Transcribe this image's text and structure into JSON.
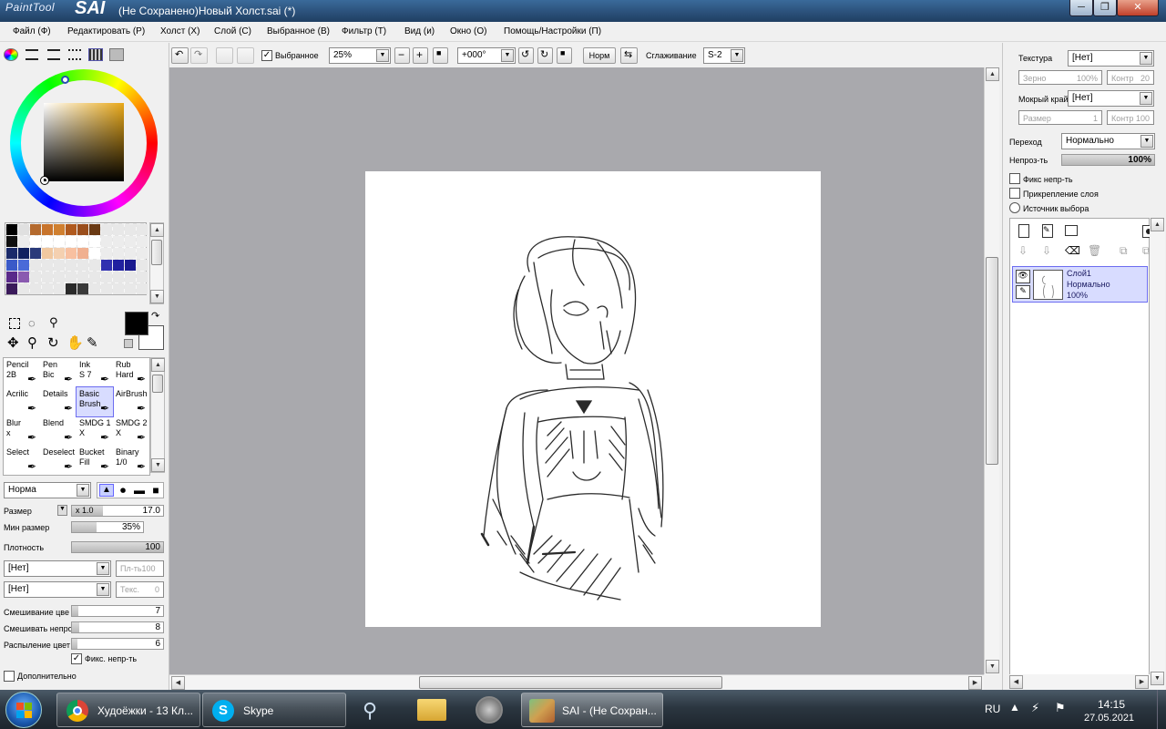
{
  "window": {
    "logo_small": "PaintTool",
    "logo_big": "SAI",
    "title": "(Не Сохранено)Новый Холст.sai (*)",
    "min": "─",
    "max": "❐",
    "close": "✕"
  },
  "menu": {
    "items": [
      "Файл (Ф)",
      "Редактировать (Р)",
      "Холст (Х)",
      "Слой (С)",
      "Выбранное (В)",
      "Фильтр (Т)",
      "Вид (и)",
      "Окно (О)",
      "Помощь/Настройки (П)"
    ]
  },
  "toolbar": {
    "selected_label": "Выбранное",
    "zoom": "25%",
    "rotation": "+000°",
    "norm": "Норм",
    "smoothing_label": "Сглаживание",
    "smoothing_value": "S-2"
  },
  "colors": {
    "title_blue": "#2a4f78",
    "canvas_bg": "#a9a9ad",
    "paper": "#ffffff",
    "selection": "#d8dcff",
    "primary": "#000000",
    "secondary": "#ffffff"
  },
  "swatches": [
    [
      "#000000",
      "#e0e0e0",
      "#b46a2e",
      "#c8742c",
      "#d08030",
      "#b05a1e",
      "#9a4e1c",
      "#6a3a14",
      "#e8e8e8",
      "#e8e8e8",
      "#e8e8e8",
      "#e8e8e8"
    ],
    [
      "#101010",
      "#ececec",
      "#ffffff",
      "#ffffff",
      "#ffffff",
      "#ffffff",
      "#ffffff",
      "#ffffff",
      "#ececec",
      "#ececec",
      "#ececec",
      "#ececec"
    ],
    [
      "#1a2a6a",
      "#102060",
      "#2a3a7a",
      "#f0c8a0",
      "#f4d0b0",
      "#f8c0a0",
      "#f0b090",
      "#ffffff",
      "#ececec",
      "#ececec",
      "#ececec",
      "#ececec"
    ],
    [
      "#3a5ac8",
      "#4a6ad8",
      "#e8e8e8",
      "#e8e8e8",
      "#e8e8e8",
      "#e8e8e8",
      "#e8e8e8",
      "#e8e8e8",
      "#3030b0",
      "#2020a0",
      "#1a1a90",
      "#e8e8e8"
    ],
    [
      "#5a2a8a",
      "#8a5ab0",
      "#e8e8e8",
      "#e8e8e8",
      "#e8e8e8",
      "#e8e8e8",
      "#e8e8e8",
      "#e8e8e8",
      "#e8e8e8",
      "#e8e8e8",
      "#e8e8e8",
      "#e8e8e8"
    ],
    [
      "#3a1a5a",
      "#e8e8e8",
      "#e8e8e8",
      "#e8e8e8",
      "#e8e8e8",
      "#2a2a2a",
      "#3a3a3a",
      "#e8e8e8",
      "#e8e8e8",
      "#e8e8e8",
      "#e8e8e8",
      "#e8e8e8"
    ]
  ],
  "tools": [
    {
      "l1": "Pencil",
      "l2": "2B"
    },
    {
      "l1": "Pen",
      "l2": "Bic"
    },
    {
      "l1": "Ink",
      "l2": "S 7"
    },
    {
      "l1": "Rub",
      "l2": "Hard"
    },
    {
      "l1": "Acrilic",
      "l2": ""
    },
    {
      "l1": "Details",
      "l2": ""
    },
    {
      "l1": "Basic",
      "l2": "Brush"
    },
    {
      "l1": "AirBrush",
      "l2": ""
    },
    {
      "l1": "Blur",
      "l2": "x"
    },
    {
      "l1": "Blend",
      "l2": ""
    },
    {
      "l1": "SMDG 1",
      "l2": "X"
    },
    {
      "l1": "SMDG 2",
      "l2": "X"
    },
    {
      "l1": "Select",
      "l2": ""
    },
    {
      "l1": "Deselect",
      "l2": ""
    },
    {
      "l1": "Bucket",
      "l2": "Fill"
    },
    {
      "l1": "Binary",
      "l2": "1/0"
    }
  ],
  "brush": {
    "mode": "Норма",
    "size_label": "Размер",
    "size_mult": "x 1.0",
    "size_value": "17.0",
    "minsize_label": "Мин размер",
    "minsize_value": "35%",
    "minsize_level": 0.35,
    "density_label": "Плотность",
    "density_value": "100",
    "density_level": 1.0,
    "tex1": "[Нет]",
    "tex1_right": "Пл-ть",
    "tex1_right_val": "100",
    "tex2": "[Нет]",
    "tex2_right": "Текс.",
    "tex2_right_val": "0",
    "blend_label": "Смешивание цве",
    "blend_value": "7",
    "blend_level": 0.07,
    "dilution_label": "Смешивать непрo",
    "dilution_value": "8",
    "dilution_level": 0.08,
    "persist_label": "Распыление цвет",
    "persist_value": "6",
    "persist_level": 0.06,
    "keep_opacity": "Фикс. непр-ть",
    "advanced": "Дополнительно"
  },
  "right": {
    "texture_label": "Текстура",
    "texture_value": "[Нет]",
    "grain_label": "Зерно",
    "grain_value": "100%",
    "contrast_label": "Контр",
    "contrast_value": "20",
    "wet_label": "Мокрый край",
    "wet_value": "[Нет]",
    "size_label": "Размер",
    "size_value": "1",
    "contr2_label": "Контр",
    "contr2_value": "100",
    "blend_label": "Переход",
    "blend_value": "Нормально",
    "opacity_label": "Непроз-ть",
    "opacity_value": "100%",
    "preserve_opacity": "Фикс непр-ть",
    "clipping": "Прикрепление слоя",
    "selection_source": "Источник выбора"
  },
  "layer": {
    "name": "Слой1",
    "mode": "Нормально",
    "opacity": "100%"
  },
  "taskbar": {
    "chrome": "Худоёжки - 13 Кл...",
    "skype": "Skype",
    "sai": "SAI - (Не Сохран...",
    "lang": "RU",
    "time": "14:15",
    "date": "27.05.2021"
  }
}
